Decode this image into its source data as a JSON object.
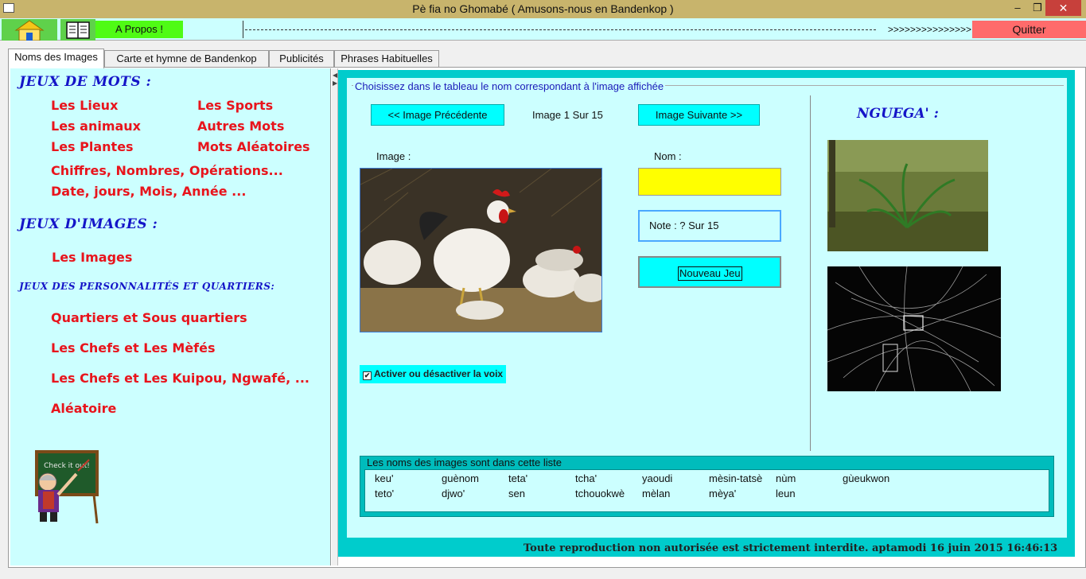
{
  "window": {
    "title": "Pè fia no Ghomabé ( Amusons-nous en Bandenkop )",
    "minimize_glyph": "–",
    "maximize_glyph": "❐",
    "close_glyph": "✕"
  },
  "toolbar": {
    "apropos_label": "A Propos !",
    "marquee_arrows": ">>>>>>>>>>>>>>>",
    "quit_label": "Quitter"
  },
  "tabs": [
    {
      "label": "Noms des Images",
      "active": true
    },
    {
      "label": "Carte et hymne de Bandenkop",
      "active": false
    },
    {
      "label": "Publicités",
      "active": false
    },
    {
      "label": "Phrases Habituelles",
      "active": false
    }
  ],
  "sidebar": {
    "jeux_mots_heading": "JEUX DE MOTS :",
    "jeux_mots_links": {
      "lieux": "Les Lieux",
      "sports": "Les Sports",
      "animaux": "Les animaux",
      "autres": "Autres Mots",
      "plantes": "Les Plantes",
      "aleatoires": "Mots Aléatoires",
      "chiffres": "Chiffres, Nombres, Opérations...",
      "date": "Date, jours, Mois, Année ..."
    },
    "jeux_images_heading": "JEUX D'IMAGES :",
    "images_link": "Les Images",
    "personnalites_heading": "JEUX DES  PERSONNALITÉS ET QUARTIERS:",
    "quartiers_link": "Quartiers et Sous quartiers",
    "chefs_mefes_link": "Les Chefs et Les Mèfés",
    "chefs_kuipou_link": "Les Chefs et Les Kuipou, Ngwafé, ...",
    "aleatoire_link": "Aléatoire",
    "board_text": "Check it out!"
  },
  "game": {
    "group_label": "Choisissez dans le tableau le nom correspondant à l'image affichée",
    "prev_button": "<< Image Précédente",
    "counter": "Image 1 Sur 15",
    "next_button": "Image Suivante >>",
    "image_label": "Image :",
    "name_label": "Nom :",
    "name_value": "",
    "note": "Note : ? Sur 15",
    "new_game_button": "Nouveau Jeu",
    "voice_checkbox": "Activer ou désactiver la voix",
    "voice_checked": true,
    "nguega_heading": "NGUEGA' :"
  },
  "word_list": {
    "legend": "Les noms des images sont dans cette liste",
    "row1": [
      "keu'",
      "guènom",
      "teta'",
      "tcha'",
      "yaoudi",
      "mèsin-tatsè",
      "nùm",
      "gùeukwon"
    ],
    "row2": [
      "teto'",
      "djwo'",
      "sen",
      "tchouokwè",
      "mèlan",
      "mèya'",
      "leun"
    ]
  },
  "footer": {
    "text": "Toute reproduction non autorisée est strictement interdite.  aptamodi 16 juin 2015 16:46:13"
  },
  "colors": {
    "title_bar": "#c8b46c",
    "panel_cyan": "#ccffff",
    "frame_teal": "#00cccc",
    "link_red": "#e8141c",
    "heading_blue": "#1515c8",
    "button_cyan": "#00ffff",
    "quit_red": "#ff6b6b",
    "name_yellow": "#ffff00"
  }
}
